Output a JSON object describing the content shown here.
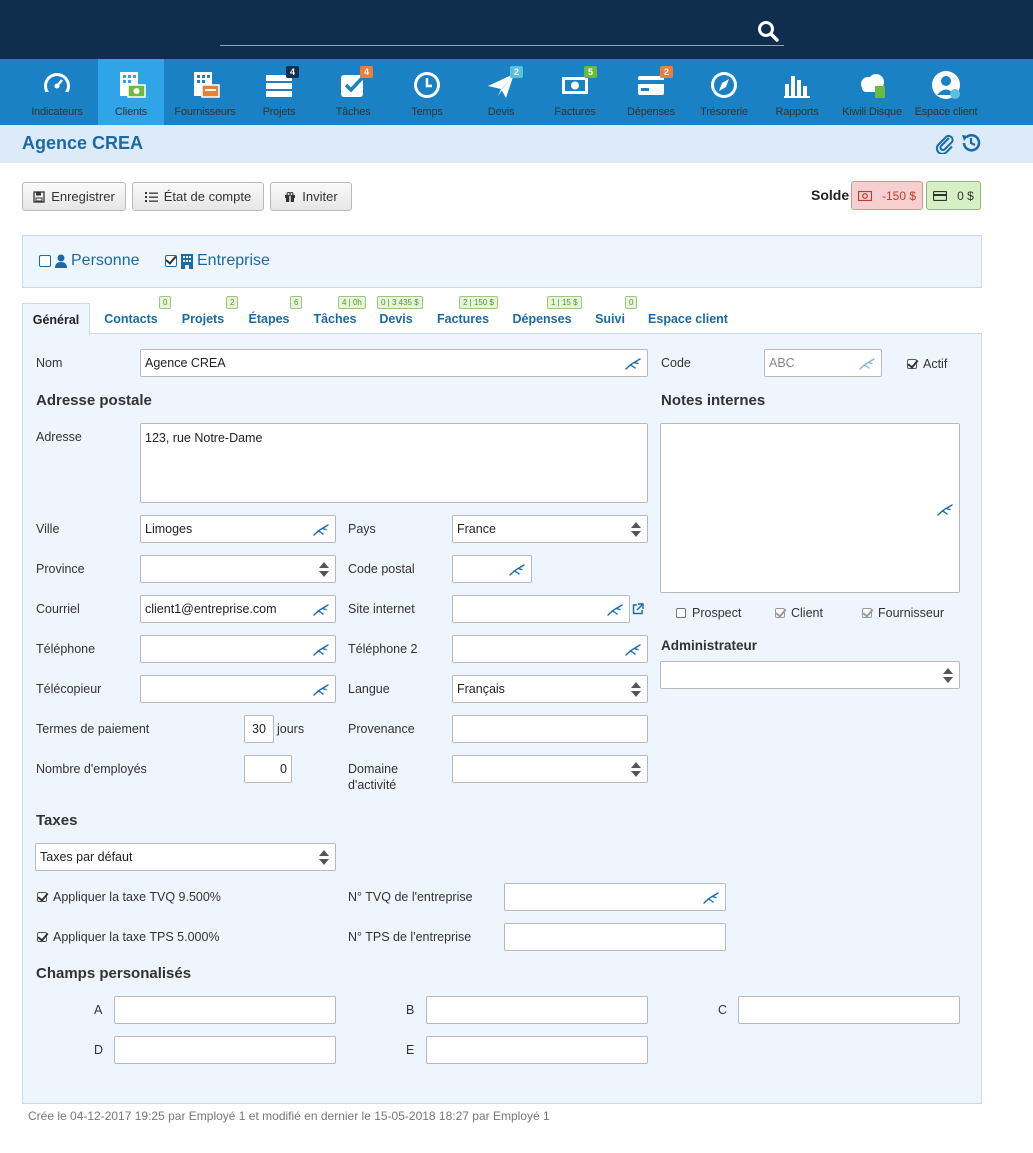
{
  "search": {
    "placeholder": ""
  },
  "nav": [
    {
      "key": "indicateurs",
      "label": "Indicateurs",
      "badge": ""
    },
    {
      "key": "clients",
      "label": "Clients",
      "badge": ""
    },
    {
      "key": "fournisseurs",
      "label": "Fournisseurs",
      "badge": ""
    },
    {
      "key": "projets",
      "label": "Projets",
      "badge": "4"
    },
    {
      "key": "taches",
      "label": "Tâches",
      "badge": "4"
    },
    {
      "key": "temps",
      "label": "Temps",
      "badge": ""
    },
    {
      "key": "devis",
      "label": "Devis",
      "badge": "2"
    },
    {
      "key": "factures",
      "label": "Factures",
      "badge": "5"
    },
    {
      "key": "depenses",
      "label": "Dépenses",
      "badge": "2"
    },
    {
      "key": "tresorerie",
      "label": "Trésorerie",
      "badge": ""
    },
    {
      "key": "rapports",
      "label": "Rapports",
      "badge": ""
    },
    {
      "key": "kiwili-disque",
      "label": "Kiwili Disque",
      "badge": ""
    },
    {
      "key": "espace-client",
      "label": "Espace client",
      "badge": ""
    }
  ],
  "page": {
    "title": "Agence CREA"
  },
  "toolbar": {
    "save_label": "Enregistrer",
    "statement_label": "État de compte",
    "invite_label": "Inviter",
    "solde_label": "Solde",
    "solde_negative": "-150 $",
    "solde_positive": "0 $"
  },
  "type": {
    "person_label": "Personne",
    "company_label": "Entreprise"
  },
  "tabs": [
    {
      "label": "Général",
      "badge": ""
    },
    {
      "label": "Contacts",
      "badge": "0"
    },
    {
      "label": "Projets",
      "badge": "2"
    },
    {
      "label": "Étapes",
      "badge": "6"
    },
    {
      "label": "Tâches",
      "badge": "4 | 0h"
    },
    {
      "label": "Devis",
      "badge": "0 | 3 435 $"
    },
    {
      "label": "Factures",
      "badge": "2 | 150 $"
    },
    {
      "label": "Dépenses",
      "badge": "1 | 15 $"
    },
    {
      "label": "Suivi",
      "badge": "0"
    },
    {
      "label": "Espace client",
      "badge": ""
    }
  ],
  "form": {
    "nom_label": "Nom",
    "nom_value": "Agence CREA",
    "code_label": "Code",
    "code_placeholder": "ABC",
    "actif_label": "Actif",
    "adresse_heading": "Adresse postale",
    "adresse_label": "Adresse",
    "adresse_value": "123, rue Notre-Dame",
    "ville_label": "Ville",
    "ville_value": "Limoges",
    "pays_label": "Pays",
    "pays_value": "France",
    "province_label": "Province",
    "province_value": "",
    "code_postal_label": "Code postal",
    "courriel_label": "Courriel",
    "courriel_value": "client1@entreprise.com",
    "site_label": "Site internet",
    "telephone_label": "Téléphone",
    "telephone2_label": "Téléphone 2",
    "telecopieur_label": "Télécopieur",
    "langue_label": "Langue",
    "langue_value": "Français",
    "termes_label": "Termes de paiement",
    "termes_value": "30",
    "jours_label": "jours",
    "provenance_label": "Provenance",
    "employes_label": "Nombre d'employés",
    "employes_value": "0",
    "domaine_label_1": "Domaine",
    "domaine_label_2": "d'activité",
    "notes_heading": "Notes internes",
    "prospect_label": "Prospect",
    "client_label": "Client",
    "fournisseur_label": "Fournisseur",
    "admin_heading": "Administrateur",
    "taxes_heading": "Taxes",
    "taxes_value": "Taxes par défaut",
    "tvq_check_label": "Appliquer la taxe TVQ 9.500%",
    "tps_check_label": "Appliquer la taxe TPS 5.000%",
    "tvq_no_label": "N° TVQ de l'entreprise",
    "tps_no_label": "N° TPS de l'entreprise",
    "champs_heading": "Champs personalisés",
    "champ_a": "A",
    "champ_b": "B",
    "champ_c": "C",
    "champ_d": "D",
    "champ_e": "E"
  },
  "footer": {
    "text": "Crée le 04-12-2017 19:25 par Employé 1 et modifié en dernier le 15-05-2018 18:27 par Employé 1"
  },
  "colors": {
    "topbar": "#0f2e4d",
    "navbar": "#1a82c4",
    "nav_active": "#2fa4e7",
    "title": "#1b6aa5",
    "panel": "#eef5fc"
  }
}
